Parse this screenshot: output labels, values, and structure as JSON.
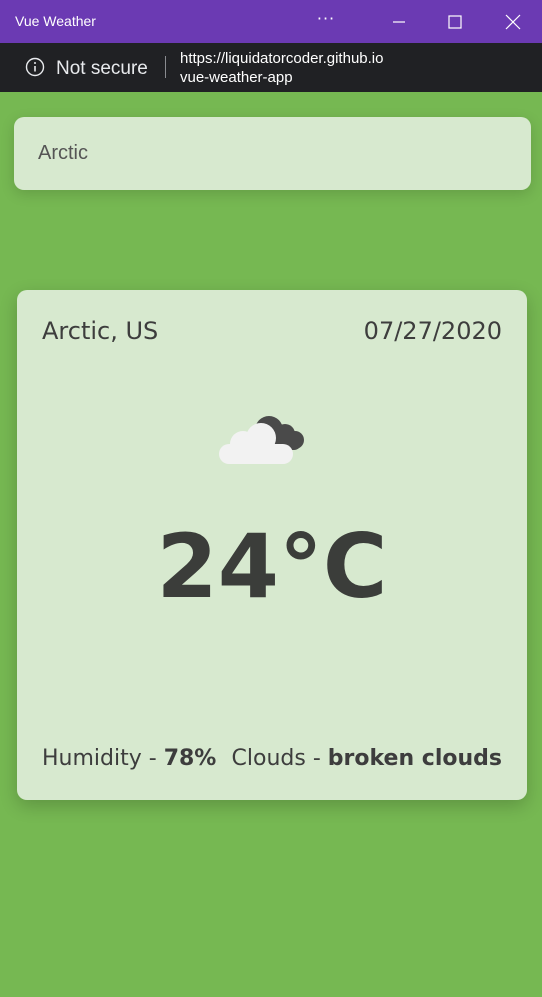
{
  "window": {
    "title": "Vue Weather",
    "more_label": "···",
    "url_line1": "https://liquidatorcoder.github.io",
    "url_line2": "vue-weather-app",
    "security_label": "Not secure"
  },
  "search": {
    "value": "Arctic"
  },
  "weather": {
    "location": "Arctic, US",
    "date": "07/27/2020",
    "icon": "broken-clouds-icon",
    "temperature": "24°C",
    "humidity_label": "Humidity -",
    "humidity_value": "78%",
    "clouds_label": "Clouds -",
    "clouds_value": "broken clouds"
  },
  "colors": {
    "background": "#76b852",
    "titlebar": "#6b3ab3",
    "card": "#d7e9cf"
  }
}
